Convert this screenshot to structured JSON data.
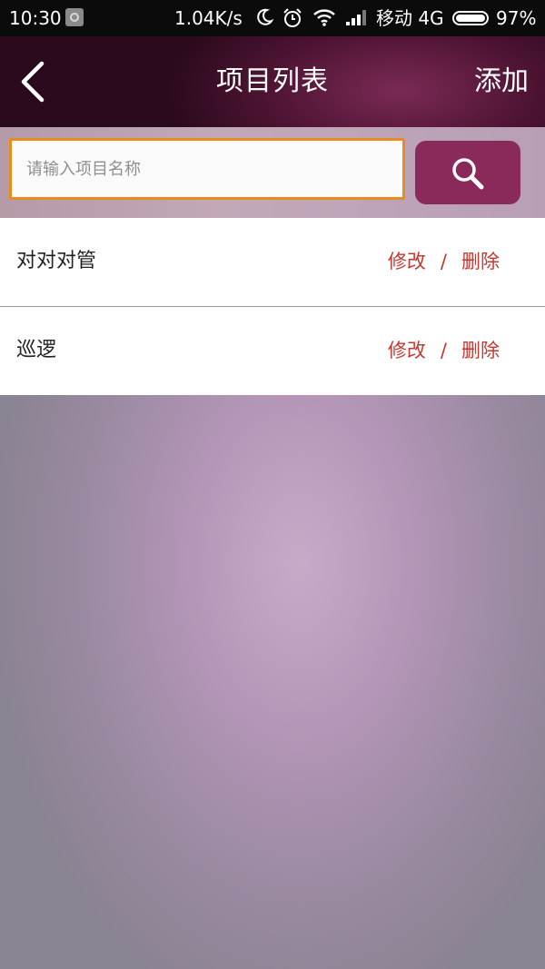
{
  "status_bar": {
    "time": "10:30",
    "net_speed": "1.04K/s",
    "carrier": "移动 4G",
    "battery": "97%",
    "icons": [
      "notification-icon",
      "moon-icon",
      "alarm-icon",
      "wifi-icon",
      "signal-icon",
      "battery-icon"
    ]
  },
  "header": {
    "title": "项目列表",
    "add_label": "添加",
    "back_icon": "chevron-left-icon"
  },
  "search": {
    "placeholder": "请输入项目名称",
    "value": "",
    "button_icon": "search-icon",
    "accent_color": "#e88a1c",
    "button_color": "#8a2a5a"
  },
  "projects": [
    {
      "name": "对对对管",
      "edit_label": "修改",
      "separator": "/",
      "delete_label": "删除"
    },
    {
      "name": "巡逻",
      "edit_label": "修改",
      "separator": "/",
      "delete_label": "删除"
    }
  ],
  "colors": {
    "header": "#4f1433",
    "action": "#c8362f"
  }
}
